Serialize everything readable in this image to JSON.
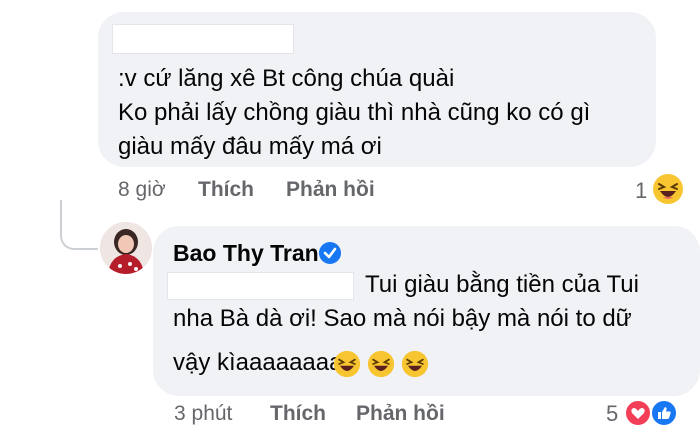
{
  "comment1": {
    "lines": [
      ":v cứ lăng xê Bt công chúa quài",
      "Ko phải lấy chồng giàu thì nhà cũng ko có gì",
      "giàu mấy đâu mấy má ơi"
    ],
    "time": "8 giờ",
    "like_label": "Thích",
    "reply_label": "Phản hồi",
    "reaction_count": "1",
    "reaction_icon": "laughing-emoji"
  },
  "comment2": {
    "author": "Bao Thy Tran",
    "verified": true,
    "lines": [
      "Tui giàu bằng tiền của Tui",
      "nha Bà dà ơi! Sao mà nói bậy mà nói to dữ",
      "vậy kìaaaaaaaa"
    ],
    "time": "3 phút",
    "like_label": "Thích",
    "reply_label": "Phản hồi",
    "reaction_count": "5",
    "reaction_icons": [
      "heart-reaction",
      "like-reaction"
    ]
  },
  "colors": {
    "bubble": "#f0f2f5",
    "meta_text": "#65676b",
    "verified_badge": "#1877f2",
    "heart": "#f33e58",
    "like": "#1877f2"
  }
}
